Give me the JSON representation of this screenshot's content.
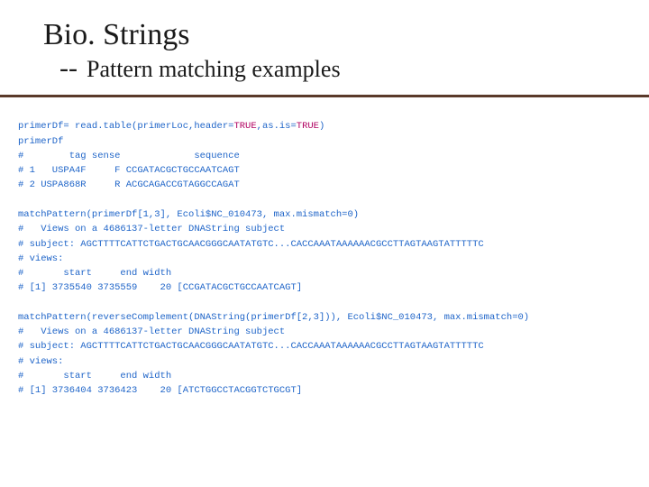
{
  "header": {
    "title": "Bio. Strings",
    "dashes": "--",
    "subtitle": "Pattern matching examples"
  },
  "code": {
    "l1a": "primerDf= read.table(primerLoc,header=",
    "l1b": "TRUE",
    "l1c": ",as.is=",
    "l1d": "TRUE",
    "l1e": ")",
    "l2": "primerDf",
    "l3": "#        tag sense             sequence",
    "l4": "# 1   USPA4F     F CCGATACGCTGCCAATCAGT",
    "l5": "# 2 USPA868R     R ACGCAGACCGTAGGCCAGAT",
    "blank1": " ",
    "l6": "matchPattern(primerDf[1,3], Ecoli$NC_010473, max.mismatch=0)",
    "l7": "#   Views on a 4686137-letter DNAString subject",
    "l8": "# subject: AGCTTTTCATTCTGACTGCAACGGGCAATATGTC...CACCAAATAAAAAACGCCTTAGTAAGTATTTTTC",
    "l9": "# views:",
    "l10": "#       start     end width",
    "l11": "# [1] 3735540 3735559    20 [CCGATACGCTGCCAATCAGT]",
    "blank2": " ",
    "l12": "matchPattern(reverseComplement(DNAString(primerDf[2,3])), Ecoli$NC_010473, max.mismatch=0)",
    "l13": "#   Views on a 4686137-letter DNAString subject",
    "l14": "# subject: AGCTTTTCATTCTGACTGCAACGGGCAATATGTC...CACCAAATAAAAAACGCCTTAGTAAGTATTTTTC",
    "l15": "# views:",
    "l16": "#       start     end width",
    "l17": "# [1] 3736404 3736423    20 [ATCTGGCCTACGGTCTGCGT]"
  }
}
